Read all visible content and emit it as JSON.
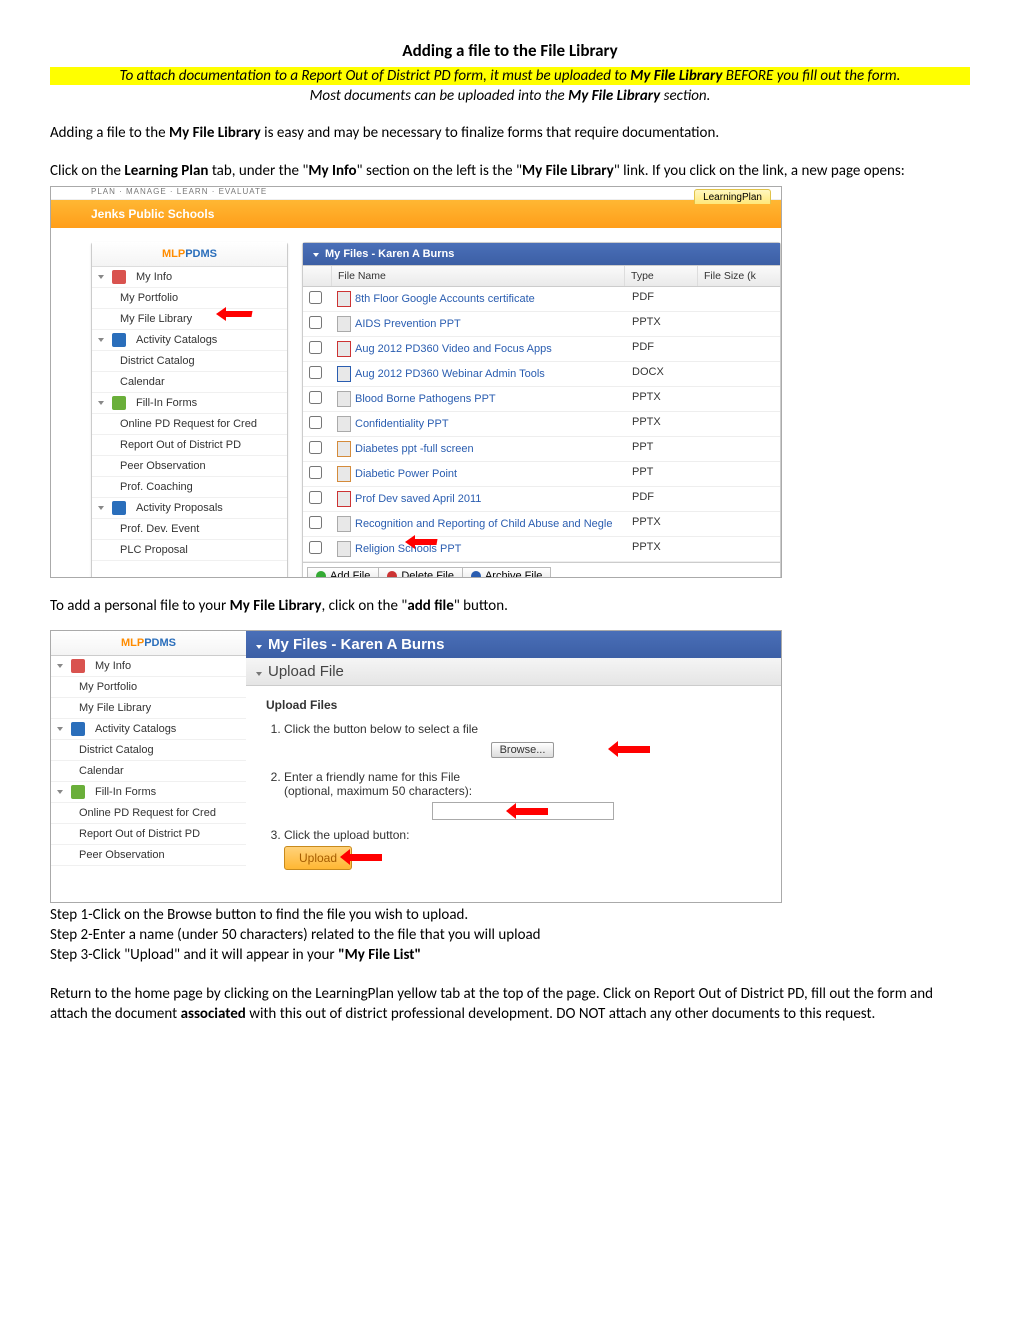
{
  "doc": {
    "title": "Adding a file to the File Library",
    "highlight_prefix": "To attach documentation to a Report Out of District PD form, it must be uploaded to ",
    "highlight_bold": "My File Library",
    "highlight_suffix": " BEFORE you fill out the form.",
    "subtitle_prefix": "Most documents can be uploaded into the ",
    "subtitle_bold": "My File Library",
    "subtitle_suffix": " section.",
    "p1_a": "Adding a file to the ",
    "p1_b": "My File Library",
    "p1_c": " is easy and may be necessary to finalize forms that require documentation.",
    "p2_a": "Click on the ",
    "p2_b": "Learning Plan",
    "p2_c": " tab, under the \"",
    "p2_d": "My Info",
    "p2_e": "\" section on the left is the \"",
    "p2_f": "My File Library",
    "p2_g": "\" link. If you click on the link, a new page opens:",
    "p3_a": "To add a personal file to your ",
    "p3_b": "My File Library",
    "p3_c": ", click on the \"",
    "p3_d": "add file",
    "p3_e": "\" button.",
    "step1": "Step 1-Click on the Browse button to find the file you wish to upload.",
    "step2": "Step 2-Enter a name (under 50 characters) related to the file that you will upload",
    "step3_a": "Step 3-Click \"Upload\" and it will appear in your ",
    "step3_b": "\"My File List\"",
    "p4_a": "Return to the home page by clicking on the LearningPlan yellow tab at the top of the page.   Click on Report Out of District PD, fill out the form and attach the document ",
    "p4_b": "associated",
    "p4_c": " with this out of district professional development.  DO NOT attach any other documents to this request."
  },
  "ss1": {
    "tab": "LearningPlan",
    "breadcrumb": "PLAN · MANAGE · LEARN · EVALUATE",
    "org": "Jenks Public Schools",
    "side_header_mlp": "MLP",
    "side_header_pdms": "PDMS",
    "side": {
      "myinfo": "My Info",
      "myportfolio": "My Portfolio",
      "myfilelibrary": "My File Library",
      "activity_catalogs": "Activity Catalogs",
      "district_catalog": "District Catalog",
      "calendar": "Calendar",
      "fillin_forms": "Fill-In Forms",
      "online_pd": "Online PD Request for Cred",
      "report_out": "Report Out of District PD",
      "peer_obs": "Peer Observation",
      "prof_coaching": "Prof. Coaching",
      "activity_proposals": "Activity Proposals",
      "prof_dev_event": "Prof. Dev. Event",
      "plc_proposal": "PLC Proposal"
    },
    "main_header": "My Files - Karen A Burns",
    "thead": {
      "name": "File Name",
      "type": "Type",
      "size": "File Size (k"
    },
    "files": [
      {
        "name": "8th Floor Google Accounts certificate",
        "type": "PDF",
        "icon": "pdf"
      },
      {
        "name": "AIDS Prevention PPT",
        "type": "PPTX",
        "icon": "pptx"
      },
      {
        "name": "Aug 2012 PD360 Video and Focus Apps",
        "type": "PDF",
        "icon": "pdf"
      },
      {
        "name": "Aug 2012 PD360 Webinar Admin Tools",
        "type": "DOCX",
        "icon": "docx"
      },
      {
        "name": "Blood Borne Pathogens PPT",
        "type": "PPTX",
        "icon": "pptx"
      },
      {
        "name": "Confidentiality PPT",
        "type": "PPTX",
        "icon": "pptx"
      },
      {
        "name": "Diabetes ppt -full screen",
        "type": "PPT",
        "icon": "ppt"
      },
      {
        "name": "Diabetic Power Point",
        "type": "PPT",
        "icon": "ppt"
      },
      {
        "name": "Prof Dev saved April 2011",
        "type": "PDF",
        "icon": "pdf"
      },
      {
        "name": "Recognition and Reporting of Child Abuse and Negle",
        "type": "PPTX",
        "icon": "pptx"
      },
      {
        "name": "Religion Schools PPT",
        "type": "PPTX",
        "icon": "pptx"
      }
    ],
    "buttons": {
      "add": "Add File",
      "delete": "Delete File",
      "archive": "Archive File"
    }
  },
  "ss2": {
    "main_header": "My Files - Karen A Burns",
    "sub_header": "Upload File",
    "section_title": "Upload Files",
    "step1": "Click the button below to select a file",
    "browse": "Browse...",
    "step2a": "Enter a friendly name for this File",
    "step2b": "(optional, maximum 50 characters):",
    "step3": "Click the upload button:",
    "upload": "Upload",
    "side": {
      "myinfo": "My Info",
      "myportfolio": "My Portfolio",
      "myfilelibrary": "My File Library",
      "activity_catalogs": "Activity Catalogs",
      "district_catalog": "District Catalog",
      "calendar": "Calendar",
      "fillin_forms": "Fill-In Forms",
      "online_pd": "Online PD Request for Cred",
      "report_out": "Report Out of District PD",
      "peer_obs": "Peer Observation"
    }
  }
}
